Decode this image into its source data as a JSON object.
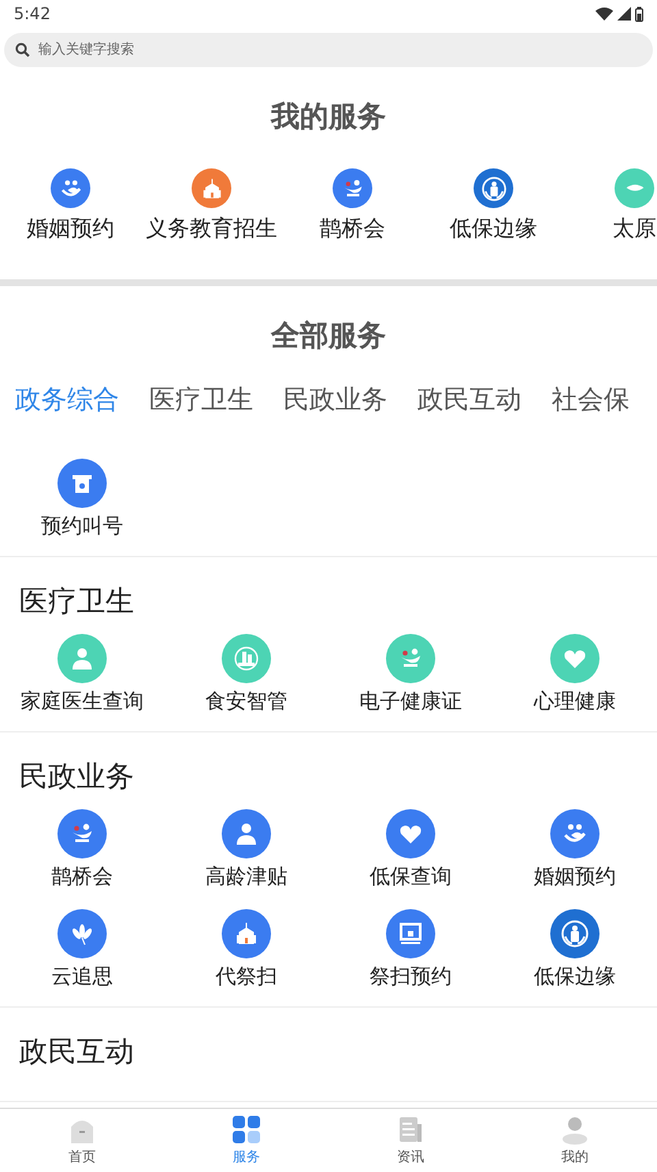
{
  "status_bar": {
    "time": "5:42"
  },
  "search": {
    "placeholder": "输入关键字搜索"
  },
  "my_services": {
    "title": "我的服务",
    "items": [
      {
        "label": "婚姻预约",
        "color": "#3b7cf0"
      },
      {
        "label": "义务教育招生",
        "color": "#f07a3a"
      },
      {
        "label": "鹊桥会",
        "color": "#3b7cf0"
      },
      {
        "label": "低保边缘",
        "color": "#1f6fd1"
      },
      {
        "label": "太原",
        "color": "#4dd4b4"
      }
    ]
  },
  "all_services": {
    "title": "全部服务",
    "tabs": [
      {
        "label": "政务综合",
        "selected": true
      },
      {
        "label": "医疗卫生",
        "selected": false
      },
      {
        "label": "民政业务",
        "selected": false
      },
      {
        "label": "政民互动",
        "selected": false
      },
      {
        "label": "社会保",
        "selected": false
      }
    ]
  },
  "sections": [
    {
      "items": [
        {
          "label": "预约叫号",
          "color": "#3b7cf0"
        }
      ]
    },
    {
      "heading": "医疗卫生",
      "items": [
        {
          "label": "家庭医生查询",
          "color": "#4dd4b4"
        },
        {
          "label": "食安智管",
          "color": "#4dd4b4"
        },
        {
          "label": "电子健康证",
          "color": "#4dd4b4"
        },
        {
          "label": "心理健康",
          "color": "#4dd4b4"
        }
      ]
    },
    {
      "heading": "民政业务",
      "items": [
        {
          "label": "鹊桥会",
          "color": "#3b7cf0"
        },
        {
          "label": "高龄津贴",
          "color": "#3b7cf0"
        },
        {
          "label": "低保查询",
          "color": "#3b7cf0"
        },
        {
          "label": "婚姻预约",
          "color": "#3b7cf0"
        },
        {
          "label": "云追思",
          "color": "#3b7cf0"
        },
        {
          "label": "代祭扫",
          "color": "#3b7cf0"
        },
        {
          "label": "祭扫预约",
          "color": "#3b7cf0"
        },
        {
          "label": "低保边缘",
          "color": "#1f6fd1"
        }
      ]
    },
    {
      "heading": "政民互动"
    }
  ],
  "bottom_nav": [
    {
      "label": "首页",
      "selected": false
    },
    {
      "label": "服务",
      "selected": true
    },
    {
      "label": "资讯",
      "selected": false
    },
    {
      "label": "我的",
      "selected": false
    }
  ]
}
